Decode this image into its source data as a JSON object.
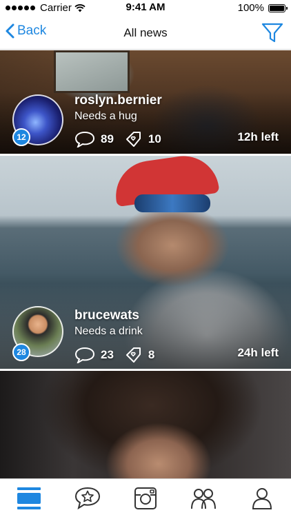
{
  "status_bar": {
    "carrier": "Carrier",
    "time": "9:41 AM",
    "battery": "100%"
  },
  "nav": {
    "back_label": "Back",
    "title": "All news",
    "accent_color": "#1e87e0"
  },
  "feed": [
    {
      "username": "roslyn.bernier",
      "status": "Needs a hug",
      "badge": "12",
      "comments": "89",
      "likes": "10",
      "time_left": "12h left"
    },
    {
      "username": "brucewats",
      "status": "Needs a drink",
      "badge": "28",
      "comments": "23",
      "likes": "8",
      "time_left": "24h left"
    }
  ],
  "tabs": [
    {
      "icon": "feed-icon"
    },
    {
      "icon": "star-speech-icon"
    },
    {
      "icon": "instagram-icon"
    },
    {
      "icon": "friends-icon"
    },
    {
      "icon": "profile-icon"
    }
  ]
}
